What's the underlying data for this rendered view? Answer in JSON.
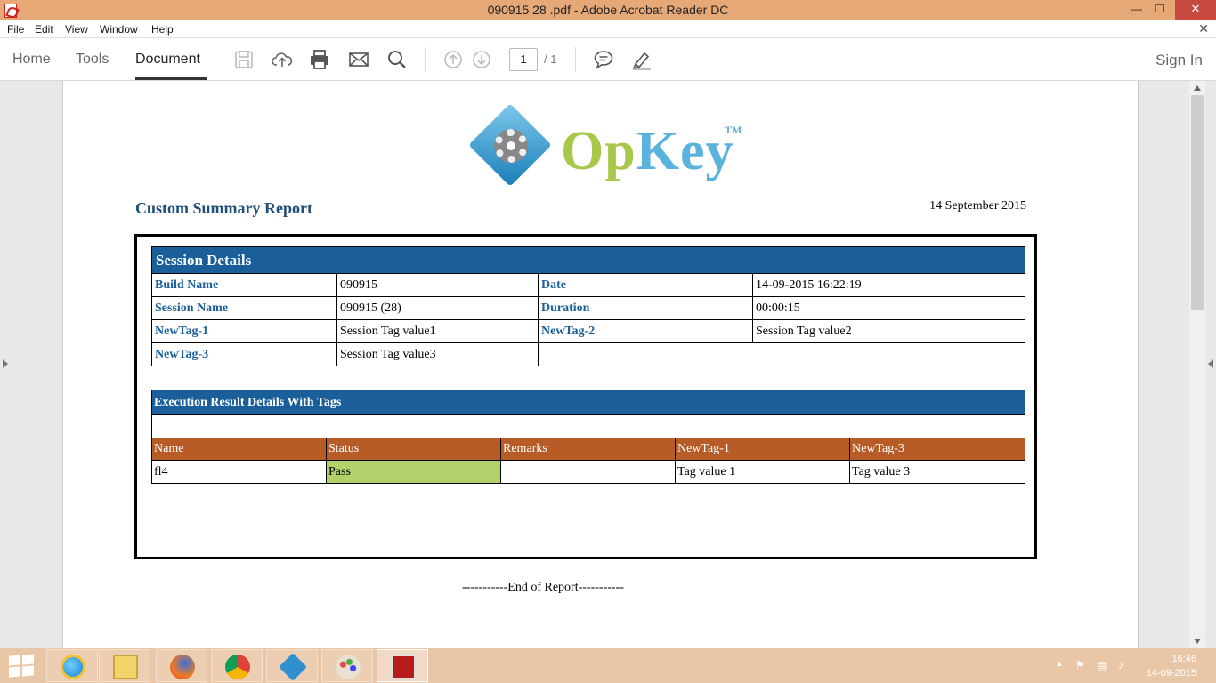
{
  "window": {
    "title": "090915  28 .pdf - Adobe Acrobat Reader DC",
    "minimize": "—",
    "restore": "❐",
    "close": "✕"
  },
  "menu": {
    "items": [
      "File",
      "Edit",
      "View",
      "Window",
      "Help"
    ],
    "close": "✕"
  },
  "toolbar": {
    "tabs": [
      "Home",
      "Tools",
      "Document"
    ],
    "active_tab": "Document",
    "page_current": "1",
    "page_total": "/ 1",
    "sign_in": "Sign In",
    "icons": [
      "save-icon",
      "upload-cloud-icon",
      "print-icon",
      "email-icon",
      "search-icon",
      "page-up-icon",
      "page-down-icon",
      "comment-icon",
      "highlight-pen-icon"
    ]
  },
  "report": {
    "logo_part1": "Op",
    "logo_part2": "Key",
    "logo_tm": "TM",
    "title": "Custom Summary Report",
    "date": "14 September 2015",
    "session_header": "Session Details",
    "session_rows": [
      {
        "label1": "Build Name",
        "value1": "090915",
        "label2": "Date",
        "value2": "14-09-2015 16:22:19"
      },
      {
        "label1": "Session Name",
        "value1": "090915 (28)",
        "label2": "Duration",
        "value2": "00:00:15"
      },
      {
        "label1": "NewTag-1",
        "value1": "Session Tag value1",
        "label2": "NewTag-2",
        "value2": "Session Tag value2"
      },
      {
        "label1": "NewTag-3",
        "value1": "Session Tag value3",
        "label2": "",
        "value2": ""
      }
    ],
    "exec_header": "Execution Result Details With Tags",
    "columns": [
      "Name",
      "Status",
      "Remarks",
      "NewTag-1",
      "NewTag-3"
    ],
    "rows": [
      {
        "name": "fl4",
        "status": "Pass",
        "remarks": "",
        "tag1": "Tag value 1",
        "tag3": "Tag value 3"
      }
    ],
    "end": "-----------End of Report-----------"
  },
  "taskbar": {
    "time": "16:46",
    "date": "14-09-2015",
    "apps": [
      "internet-explorer-icon",
      "file-explorer-icon",
      "firefox-icon",
      "chrome-icon",
      "opkey-icon",
      "paint-icon",
      "acrobat-icon"
    ]
  }
}
